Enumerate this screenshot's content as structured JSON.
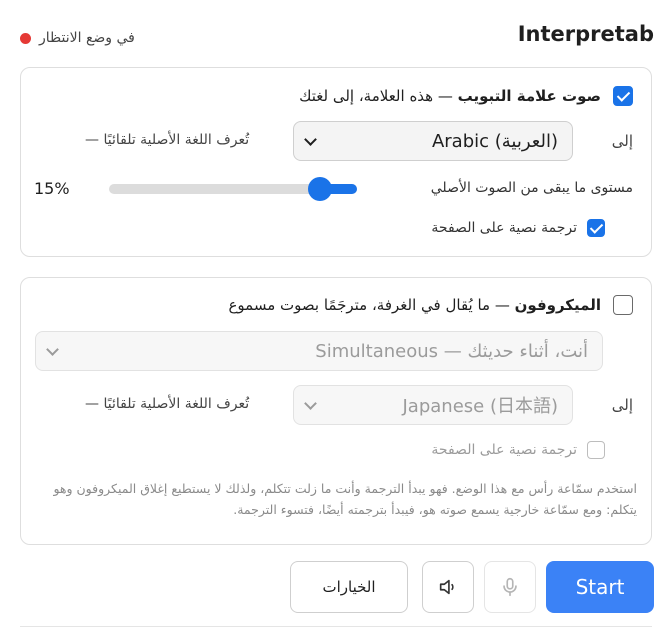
{
  "header": {
    "title": "Interpretab",
    "status_text": "في وضع الانتظار",
    "status_color": "#e53935"
  },
  "tab_audio": {
    "checked": true,
    "title": "صوت علامة التبويب",
    "subtitle": " — هذه العلامة، إلى لغتك",
    "to_label": "إلى",
    "language_value": "Arabic (العربية)",
    "auto_detect_hint": "— تُعرف اللغة الأصلية تلقائيًا",
    "original_volume_label": "مستوى ما يبقى من الصوت الأصلي",
    "original_volume_value": 15,
    "original_volume_text": "15%",
    "transcript_label": "ترجمة نصية على الصفحة",
    "transcript_checked": true
  },
  "microphone": {
    "checked": false,
    "title": "الميكروفون",
    "subtitle": " — ما يُقال في الغرفة، مترجَمًا بصوت مسموع",
    "mode_value": "Simultaneous — أنت، أثناء حديثك",
    "to_label": "إلى",
    "language_value": "Japanese (日本語)",
    "auto_detect_hint": "— تُعرف اللغة الأصلية تلقائيًا",
    "transcript_label": "ترجمة نصية على الصفحة",
    "transcript_checked": false,
    "note": "استخدم سمّاعة رأس مع هذا الوضع. فهو يبدأ الترجمة وأنت ما زلت تتكلم، ولذلك لا يستطيع إغلاق الميكروفون وهو يتكلم: ومع سمّاعة خارجية يسمع صوته هو، فيبدأ بترجمته أيضًا، فتسوء الترجمة."
  },
  "actions": {
    "options_label": "الخيارات",
    "speaker_icon": "speaker-icon",
    "mic_icon": "microphone-icon",
    "start_label": "Start",
    "start_color": "#3b82f6"
  }
}
